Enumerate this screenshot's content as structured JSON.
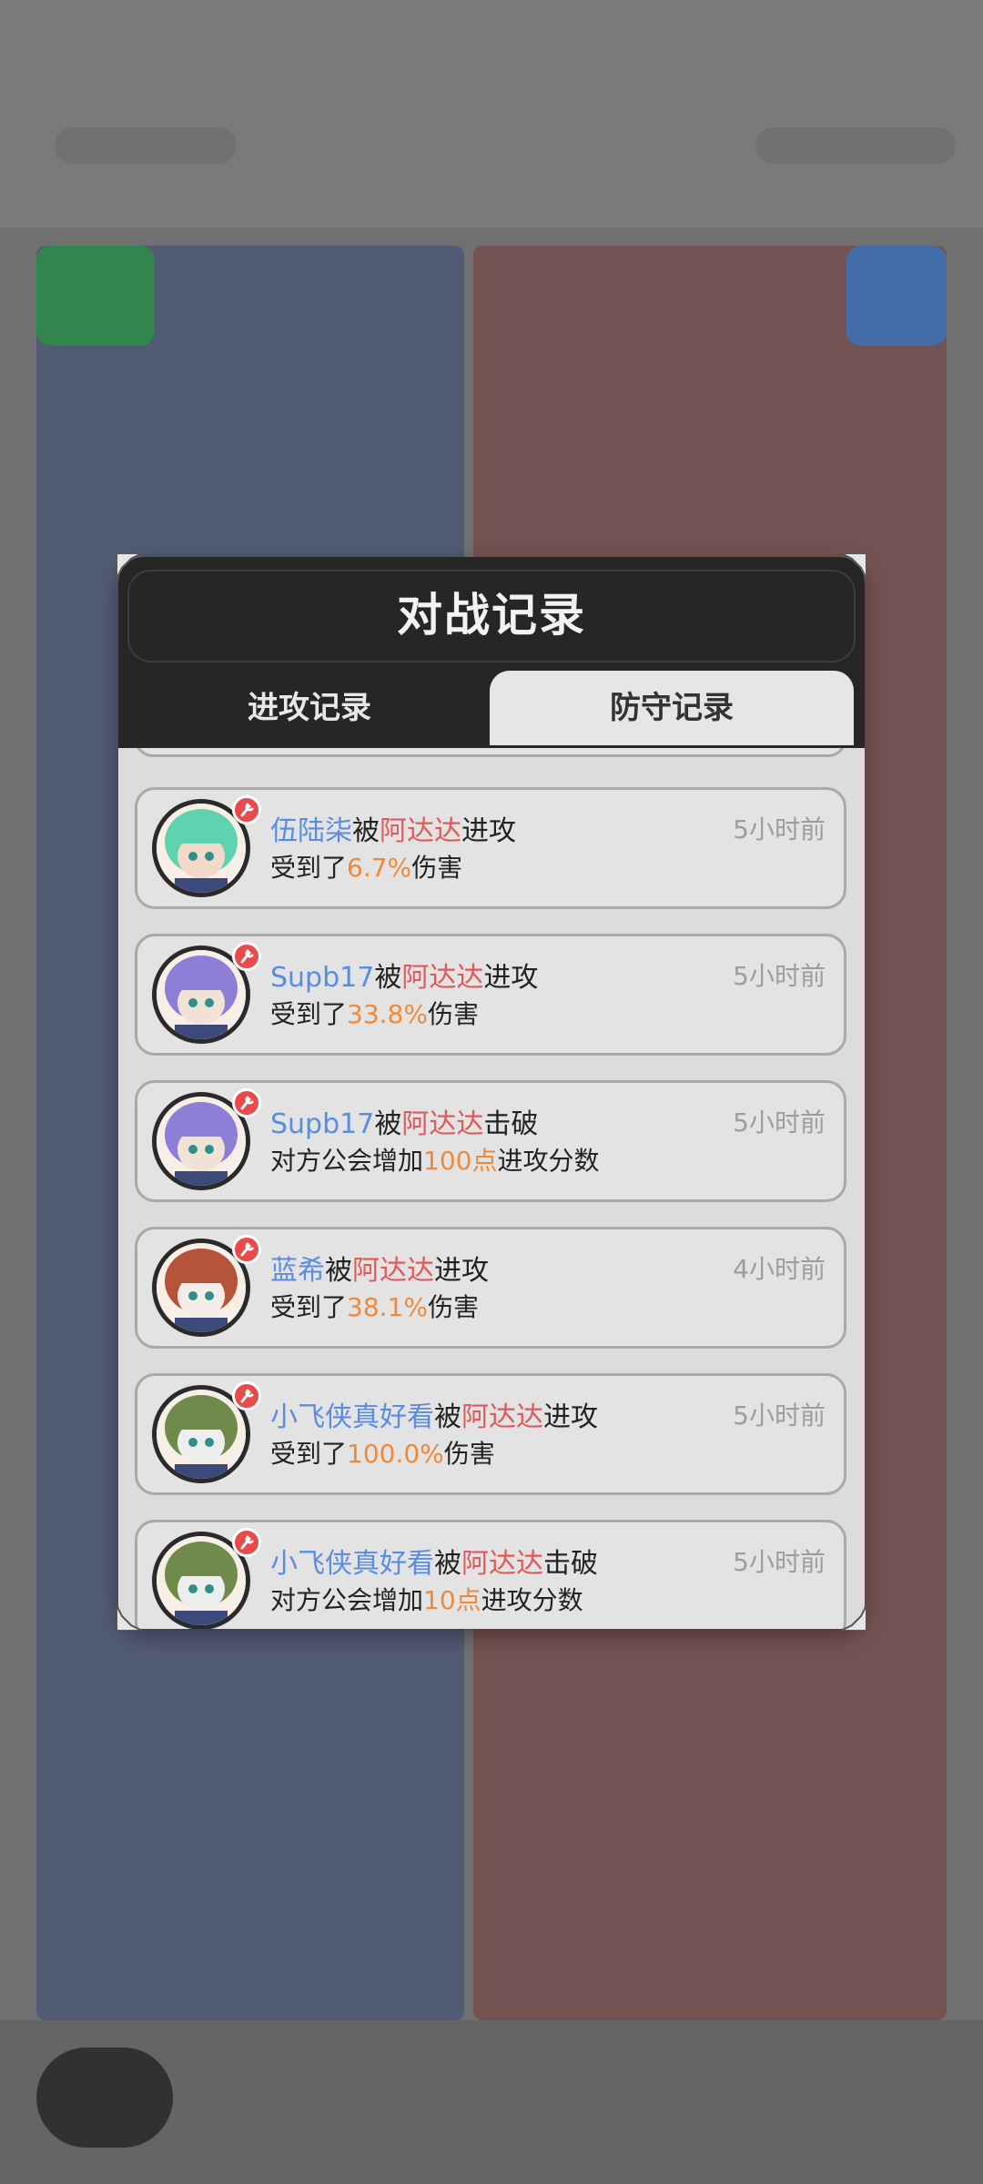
{
  "dialog": {
    "title": "对战记录",
    "tabs": [
      {
        "label": "进攻记录",
        "active": false
      },
      {
        "label": "防守记录",
        "active": true
      }
    ]
  },
  "records": [
    {
      "name": "伍陆柒",
      "mid": "被",
      "attacker": "阿达达",
      "action": "进攻",
      "time": "5小时前",
      "d_prefix": "受到了",
      "d_value": "6.7%",
      "d_suffix": "伤害",
      "avatar_colors": [
        "#5fd3b0",
        "#f3d9c9"
      ]
    },
    {
      "name": "Supb17",
      "mid": "被",
      "attacker": "阿达达",
      "action": "进攻",
      "time": "5小时前",
      "d_prefix": "受到了",
      "d_value": "33.8%",
      "d_suffix": "伤害",
      "avatar_colors": [
        "#8d7fd8",
        "#f1e2d6"
      ]
    },
    {
      "name": "Supb17",
      "mid": "被",
      "attacker": "阿达达",
      "action": "击破",
      "time": "5小时前",
      "d_prefix": "对方公会增加",
      "d_value": "100点",
      "d_suffix": "进攻分数",
      "avatar_colors": [
        "#8d7fd8",
        "#f1e2d6"
      ]
    },
    {
      "name": "蓝希",
      "mid": "被",
      "attacker": "阿达达",
      "action": "进攻",
      "time": "4小时前",
      "d_prefix": "受到了",
      "d_value": "38.1%",
      "d_suffix": "伤害",
      "avatar_colors": [
        "#b5543a",
        "#f4ece6"
      ]
    },
    {
      "name": "小飞侠真好看",
      "mid": "被",
      "attacker": "阿达达",
      "action": "进攻",
      "time": "5小时前",
      "d_prefix": "受到了",
      "d_value": "100.0%",
      "d_suffix": "伤害",
      "avatar_colors": [
        "#6f8a4a",
        "#eeeeee"
      ]
    },
    {
      "name": "小飞侠真好看",
      "mid": "被",
      "attacker": "阿达达",
      "action": "击破",
      "time": "5小时前",
      "d_prefix": "对方公会增加",
      "d_value": "10点",
      "d_suffix": "进攻分数",
      "avatar_colors": [
        "#6f8a4a",
        "#eeeeee"
      ]
    }
  ],
  "colors": {
    "name": "#5a8de0",
    "attacker": "#e05a5a",
    "value": "#ef8a3a",
    "badge": "#e94b4b"
  }
}
